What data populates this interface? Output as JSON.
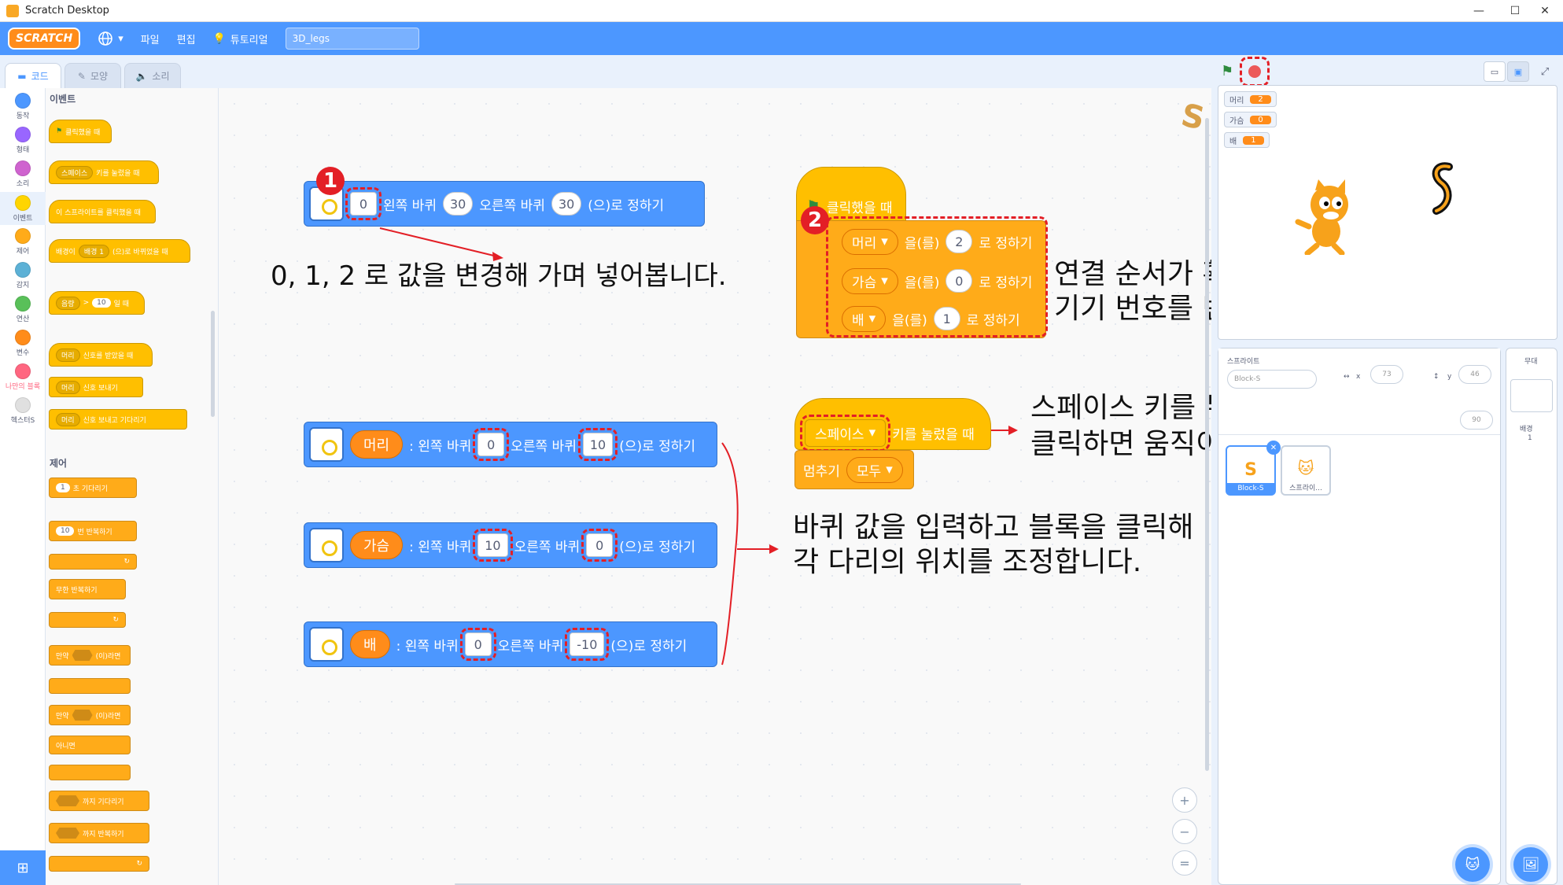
{
  "window": {
    "title": "Scratch Desktop",
    "minimize": "—",
    "maximize": "☐",
    "close": "✕"
  },
  "menubar": {
    "logo": "SCRATCH",
    "language_icon": "globe-icon",
    "file": "파일",
    "edit": "편집",
    "tutorials": "튜토리얼",
    "project_name": "3D_legs"
  },
  "tabs": {
    "code": "코드",
    "costumes": "모양",
    "sounds": "소리"
  },
  "categories": [
    {
      "label": "동작",
      "color": "#4c97ff"
    },
    {
      "label": "형태",
      "color": "#9966ff"
    },
    {
      "label": "소리",
      "color": "#cf63cf"
    },
    {
      "label": "이벤트",
      "color": "#ffd500"
    },
    {
      "label": "제어",
      "color": "#ffab19"
    },
    {
      "label": "감지",
      "color": "#5cb1d6"
    },
    {
      "label": "연산",
      "color": "#59c059"
    },
    {
      "label": "변수",
      "color": "#ff8c1a"
    },
    {
      "label": "나만의 블록",
      "color": "#ff6680"
    },
    {
      "label": "헥스터S",
      "color": "#e0e0e0"
    }
  ],
  "palette": {
    "events_title": "이벤트",
    "ev_flag": "클릭했을 때",
    "ev_key_drop": "스페이스",
    "ev_key": "키를 눌렀을 때",
    "ev_sprite": "이 스프라이트를 클릭했을 때",
    "ev_backdrop_pre": "배경이",
    "ev_backdrop_drop": "배경 1",
    "ev_backdrop_post": "(으)로 바뀌었을 때",
    "ev_loud_drop": "음량",
    "ev_loud_gt": ">",
    "ev_loud_val": "10",
    "ev_loud_post": "일 때",
    "ev_recv_drop": "머리",
    "ev_recv": "신호를 받았을 때",
    "ev_bcast_drop": "머리",
    "ev_bcast": "신호 보내기",
    "ev_bcastw_drop": "머리",
    "ev_bcastw": "신호 보내고 기다리기",
    "control_title": "제어",
    "ct_wait_val": "1",
    "ct_wait": "초 기다리기",
    "ct_repeat_val": "10",
    "ct_repeat": "번 반복하기",
    "ct_forever": "무한 반복하기",
    "ct_if_pre": "만약",
    "ct_if_post": "(이)라면",
    "ct_ifelse_pre": "만약",
    "ct_ifelse_post": "(이)라면",
    "ct_else": "아니면",
    "ct_waituntil": "까지 기다리기",
    "ct_repeatuntil": "까지 반복하기"
  },
  "blocks": {
    "b1": {
      "left_label": "왼쪽 바퀴",
      "left_val": "30",
      "right_label": "오른쪽 바퀴",
      "right_val": "30",
      "suffix": "(으)로 정하기",
      "first_val": "0"
    },
    "hat_flag": "클릭했을 때",
    "set_rows": [
      {
        "var": "머리",
        "mid": "을(를)",
        "val": "2",
        "post": "로 정하기"
      },
      {
        "var": "가슴",
        "mid": "을(를)",
        "val": "0",
        "post": "로 정하기"
      },
      {
        "var": "배",
        "mid": "을(를)",
        "val": "1",
        "post": "로 정하기"
      }
    ],
    "key_drop": "스페이스",
    "key_label": "키를 눌렀을 때",
    "stop_label": "멈추기",
    "stop_drop": "모두",
    "leg_rows": [
      {
        "var": "머리",
        "left_label": ": 왼쪽 바퀴",
        "left_val": "0",
        "right_label": "오른쪽 바퀴",
        "right_val": "10",
        "suffix": "(으)로 정하기"
      },
      {
        "var": "가슴",
        "left_label": ": 왼쪽 바퀴",
        "left_val": "10",
        "right_label": "오른쪽 바퀴",
        "right_val": "0",
        "suffix": "(으)로 정하기"
      },
      {
        "var": "배",
        "left_label": ": 왼쪽 바퀴",
        "left_val": "0",
        "right_label": "오른쪽 바퀴",
        "right_val": "-10",
        "suffix": "(으)로 정하기"
      }
    ]
  },
  "annotations": {
    "badge1": "1",
    "badge2": "2",
    "note1": "0, 1, 2 로 값을 변경해 가며 넣어봅니다.",
    "note2_l1": "연결 순서가 확인되면 각 부위에 해당하는",
    "note2_l2": "기기 번호를 변수 값으로 입력합니다.",
    "note3_l1": "스페이스 키를 누르거나 정지 버튼을",
    "note3_l2": "클릭하면 움직이던 다리가 모두 멈춥니다.",
    "note4_l1": "바퀴 값을 입력하고 블록을 클릭해",
    "note4_l2": "각 다리의 위치를 조정합니다.",
    "red": "#e31f26"
  },
  "zoom": {
    "in": "+",
    "out": "−",
    "reset": "="
  },
  "stage": {
    "monitors": [
      {
        "label": "머리",
        "value": "2"
      },
      {
        "label": "가슴",
        "value": "0"
      },
      {
        "label": "배",
        "value": "1"
      }
    ]
  },
  "sprite_pane": {
    "title": "스프라이트",
    "name": "Block-S",
    "x_label": "x",
    "x": "73",
    "y_label": "y",
    "y": "46",
    "direction": "90",
    "sprites": [
      {
        "name": "Block-S"
      },
      {
        "name": "스프라이..."
      }
    ]
  },
  "stage_pane": {
    "title": "무대",
    "backdrop_label": "배경",
    "backdrop_count": "1"
  }
}
